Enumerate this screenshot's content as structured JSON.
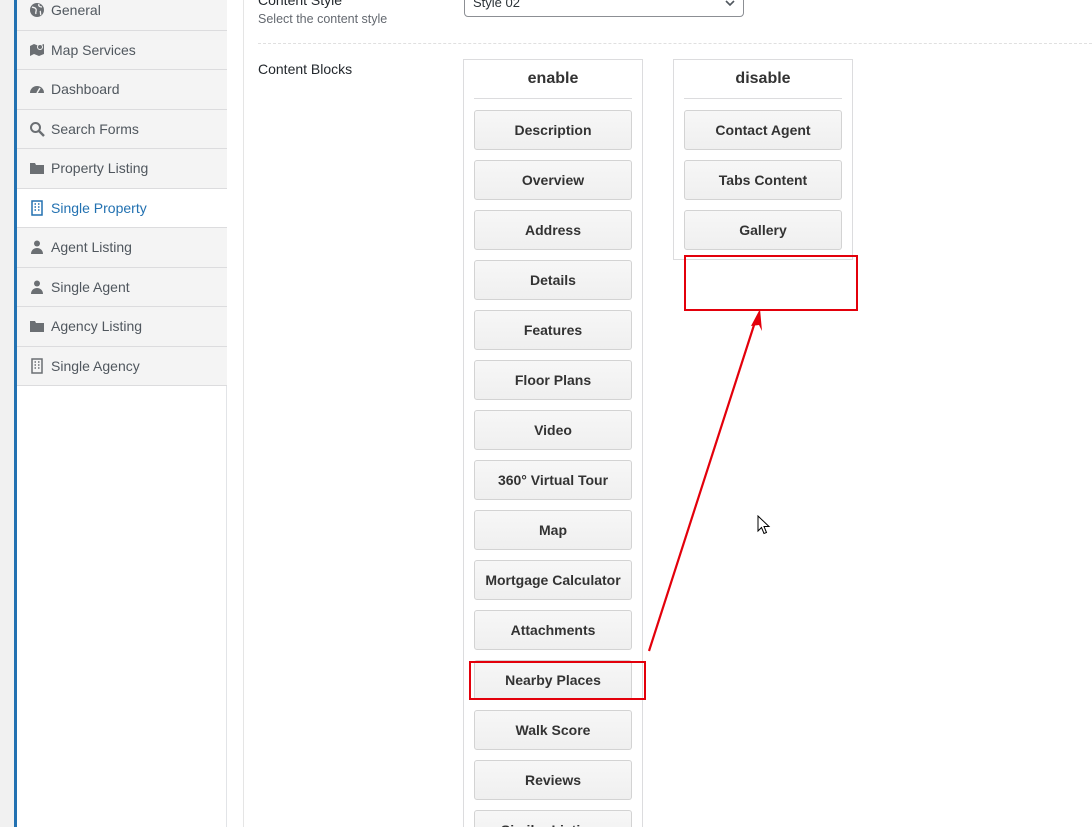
{
  "sidebar": {
    "items": [
      {
        "label": "General",
        "icon": "globe-icon",
        "active": false
      },
      {
        "label": "Map Services",
        "icon": "map-icon",
        "active": false
      },
      {
        "label": "Dashboard",
        "icon": "dashboard-icon",
        "active": false
      },
      {
        "label": "Search Forms",
        "icon": "search-icon",
        "active": false
      },
      {
        "label": "Property Listing",
        "icon": "folder-icon",
        "active": false
      },
      {
        "label": "Single Property",
        "icon": "building-icon",
        "active": true
      },
      {
        "label": "Agent Listing",
        "icon": "user-icon",
        "active": false
      },
      {
        "label": "Single Agent",
        "icon": "user-icon",
        "active": false
      },
      {
        "label": "Agency Listing",
        "icon": "folder-icon",
        "active": false
      },
      {
        "label": "Single Agency",
        "icon": "building-icon",
        "active": false
      }
    ]
  },
  "content_style": {
    "title": "Content Style",
    "description": "Select the content style",
    "selected": "Style 02"
  },
  "content_blocks": {
    "label": "Content Blocks",
    "enable": {
      "heading": "enable",
      "items": [
        "Description",
        "Overview",
        "Address",
        "Details",
        "Features",
        "Floor Plans",
        "Video",
        "360° Virtual Tour",
        "Map",
        "Mortgage Calculator",
        "Attachments",
        "Nearby Places",
        "Walk Score",
        "Reviews",
        "Similar Listings"
      ]
    },
    "disable": {
      "heading": "disable",
      "items": [
        "Contact Agent",
        "Tabs Content",
        "Gallery"
      ]
    }
  },
  "colors": {
    "accent": "#2271b1",
    "annotation": "#e3000b"
  }
}
